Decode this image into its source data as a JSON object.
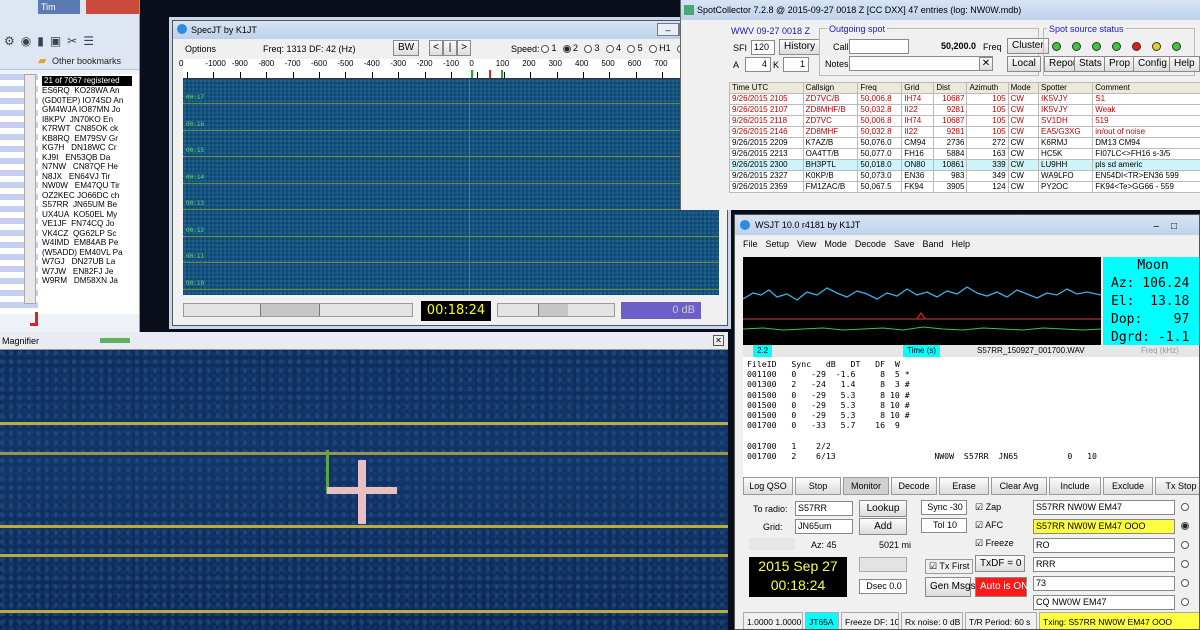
{
  "browser": {
    "tab_label": "Tim",
    "bookmarks_label": "Other bookmarks",
    "list_header": "21 of 7067 registered",
    "rows": [
      "ES6RQ  KO28WA An",
      "(GD0TEP) IO74SD An",
      "GM4WJA IO87MN Jo",
      "I8KPV  JN70KO En",
      "K7RWT  CN85OK ck",
      "KB8RQ  EM79SV Gr",
      "KG7H   DN18WC Cr",
      "KJ9I   EN53QB Da",
      "N7NW   CN87QF He",
      "N8JX   EN64VJ Tir",
      "NW0W   EM47QU Tir",
      "OZ2KEC JO66DC ch",
      "S57RR  JN65UM Be",
      "UX4UA  KO50EL My",
      "VE1JF  FN74CQ Jo",
      "VK4CZ  QG62LP Sc",
      "W4IMD  EM84AB Pe",
      "(W5ADD) EM40VL Pa",
      "W7GJ   DN27UB La",
      "W7JW   EN82FJ Je",
      "W9RM   DM58XN Ja"
    ]
  },
  "magnifier": {
    "title": "Magnifier"
  },
  "specjt": {
    "title": "SpecJT    by K1JT",
    "options_label": "Options",
    "freq_text": "Freq: 1313   DF:  42  (Hz)",
    "bw_label": "BW",
    "speed_label": "Speed:",
    "speed_options": [
      "1",
      "2",
      "3",
      "4",
      "5",
      "H1",
      "H2"
    ],
    "ruler_ticks": [
      "0",
      "-1000",
      "-900",
      "-800",
      "-700",
      "-600",
      "-500",
      "-400",
      "-300",
      "-200",
      "-100",
      "0",
      "100",
      "200",
      "300",
      "400",
      "500",
      "600",
      "700",
      "800",
      "900"
    ],
    "wf_labels": [
      "00:17",
      "00:16",
      "00:15",
      "00:14",
      "00:13",
      "00:12",
      "00:11",
      "00:10"
    ],
    "clock": "00:18:24",
    "db": "0 dB"
  },
  "spot": {
    "title": "SpotCollector 7.2.8 @ 2015-09-27 0018 Z [CC DXX] 47 entries (log: NW0W.mdb)",
    "wwv_label": "WWV 09-27 0018 Z",
    "sfi_label": "SFI",
    "sfi": "120",
    "a_label": "A",
    "a": "4",
    "k_label": "K",
    "k": "1",
    "history_label": "History",
    "outgoing_label": "Outgoing spot",
    "call_label": "Call",
    "notes_label": "Notes",
    "freq_value": "50,200.0",
    "freq_label": "Freq",
    "cluster_label": "Cluster",
    "local_label": "Local",
    "sources_label": "Spot source status",
    "report_label": "Report",
    "stats_label": "Stats",
    "prop_label": "Prop",
    "config_label": "Config",
    "help_label": "Help",
    "led_colors": [
      "#39c839",
      "#39c839",
      "#39c839",
      "#39c839",
      "#e01c1c",
      "#e0d01c",
      "#39c839"
    ],
    "columns": [
      "Time UTC",
      "Callsign",
      "Freq",
      "Grid",
      "Dist",
      "Azimuth",
      "Mode",
      "Spotter",
      "Comment"
    ],
    "rows": [
      {
        "time": "9/26/2015 2105",
        "call": "ZD7VC/B",
        "freq": "50,006.8",
        "grid": "IH74",
        "dist": "10687",
        "az": "105",
        "mode": "CW",
        "spotter": "IK5VJY",
        "comment": "S1",
        "color": "#c00000"
      },
      {
        "time": "9/26/2015 2107",
        "call": "ZD8MHF/B",
        "freq": "50,032.8",
        "grid": "II22",
        "dist": "9281",
        "az": "105",
        "mode": "CW",
        "spotter": "IK5VJY",
        "comment": "Weak",
        "color": "#c00000"
      },
      {
        "time": "9/26/2015 2118",
        "call": "ZD7VC",
        "freq": "50,006.8",
        "grid": "IH74",
        "dist": "10687",
        "az": "105",
        "mode": "CW",
        "spotter": "SV1DH",
        "comment": "519",
        "color": "#c00000"
      },
      {
        "time": "9/26/2015 2146",
        "call": "ZD8MHF",
        "freq": "50,032.8",
        "grid": "II22",
        "dist": "9281",
        "az": "105",
        "mode": "CW",
        "spotter": "EA5/G3XG",
        "comment": "in/out of noise",
        "color": "#c00000"
      },
      {
        "time": "9/26/2015 2209",
        "call": "K7AZ/B",
        "freq": "50,076.0",
        "grid": "CM94",
        "dist": "2736",
        "az": "272",
        "mode": "CW",
        "spotter": "K6RMJ",
        "comment": "DM13 CM94",
        "color": "#000"
      },
      {
        "time": "9/26/2015 2213",
        "call": "OA4TT/B",
        "freq": "50,077.0",
        "grid": "FH16",
        "dist": "5884",
        "az": "163",
        "mode": "CW",
        "spotter": "HC5K",
        "comment": "FI07LC<>FH16 s-3/5",
        "color": "#000"
      },
      {
        "time": "9/26/2015 2300",
        "call": "BH3PTL",
        "freq": "50,018.0",
        "grid": "ON80",
        "dist": "10861",
        "az": "339",
        "mode": "CW",
        "spotter": "LU9HH",
        "comment": "pls sd americ",
        "color": "#000",
        "hl": true
      },
      {
        "time": "9/26/2015 2327",
        "call": "K0KP/B",
        "freq": "50,073.0",
        "grid": "EN36",
        "dist": "983",
        "az": "349",
        "mode": "CW",
        "spotter": "WA9LFO",
        "comment": "EN54DI<TR>EN36 599",
        "color": "#000"
      },
      {
        "time": "9/26/2015 2359",
        "call": "FM1ZAC/B",
        "freq": "50,067.5",
        "grid": "FK94",
        "dist": "3905",
        "az": "124",
        "mode": "CW",
        "spotter": "PY2OC",
        "comment": "FK94<Te>GG66 - 559",
        "color": "#000"
      }
    ]
  },
  "wsjt": {
    "title": "WSJT 10.0    r4181      by K1JT",
    "menu": [
      "File",
      "Setup",
      "View",
      "Mode",
      "Decode",
      "Save",
      "Band",
      "Help"
    ],
    "moon_label": "Moon",
    "moon_lines": [
      "Az: 106.24",
      "El:  13.18",
      "Dop:    97",
      "Dgrd: -1.1"
    ],
    "strip_left": "2.2",
    "time_label": "Time (s)",
    "file_label": "S57RR_150927_001700.WAV",
    "freq_khz": "Freq (kHz)",
    "decode_header": "FileID   Sync   dB   DT   DF  W",
    "decode_rows": [
      "001100   0   -29  -1.6     8  5 *",
      "001300   2   -24   1.4     8  3 #",
      "001500   0   -29   5.3     8 10 #",
      "001500   0   -29   5.3     8 10 #",
      "001500   0   -29   5.3     8 10 #",
      "001700   0   -33   5.7    16  9"
    ],
    "decode_avg": [
      "001700   1    2/2",
      "001700   2    6/13                    NW0W  S57RR  JN65          0   10"
    ],
    "buttons": [
      "Log QSO",
      "Stop",
      "Monitor",
      "Decode",
      "Erase",
      "Clear Avg",
      "Include",
      "Exclude",
      "Tx Stop"
    ],
    "to_radio_label": "To radio:",
    "to_radio": "S57RR",
    "grid_label": "Grid:",
    "grid": "JN65um",
    "lookup_label": "Lookup",
    "add_label": "Add",
    "az_text": "Az: 45",
    "dist_text": "5021 mi",
    "date": "2015 Sep 27",
    "time": "00:18:24",
    "dsec": "Dsec  0.0",
    "sync_text": "Sync  -30",
    "tol_text": "Tol   10",
    "zap_label": "Zap",
    "afc_label": "AFC",
    "freeze_label": "Freeze",
    "txfirst_label": "Tx First",
    "txdf_label": "TxDF = 0",
    "genmsgs_label": "Gen Msgs",
    "auto_label": "Auto is ON",
    "tx_messages": [
      "S57RR NW0W EM47",
      "S57RR NW0W EM47 OOO",
      "RO",
      "RRR",
      "73",
      "CQ NW0W EM47"
    ],
    "status": [
      "1.0000 1.0000",
      "JT65A",
      "Freeze DF: 10",
      "Rx noise:  0 dB",
      "T/R Period: 60 s",
      "Txing:  S57RR NW0W EM47 OOO"
    ]
  }
}
